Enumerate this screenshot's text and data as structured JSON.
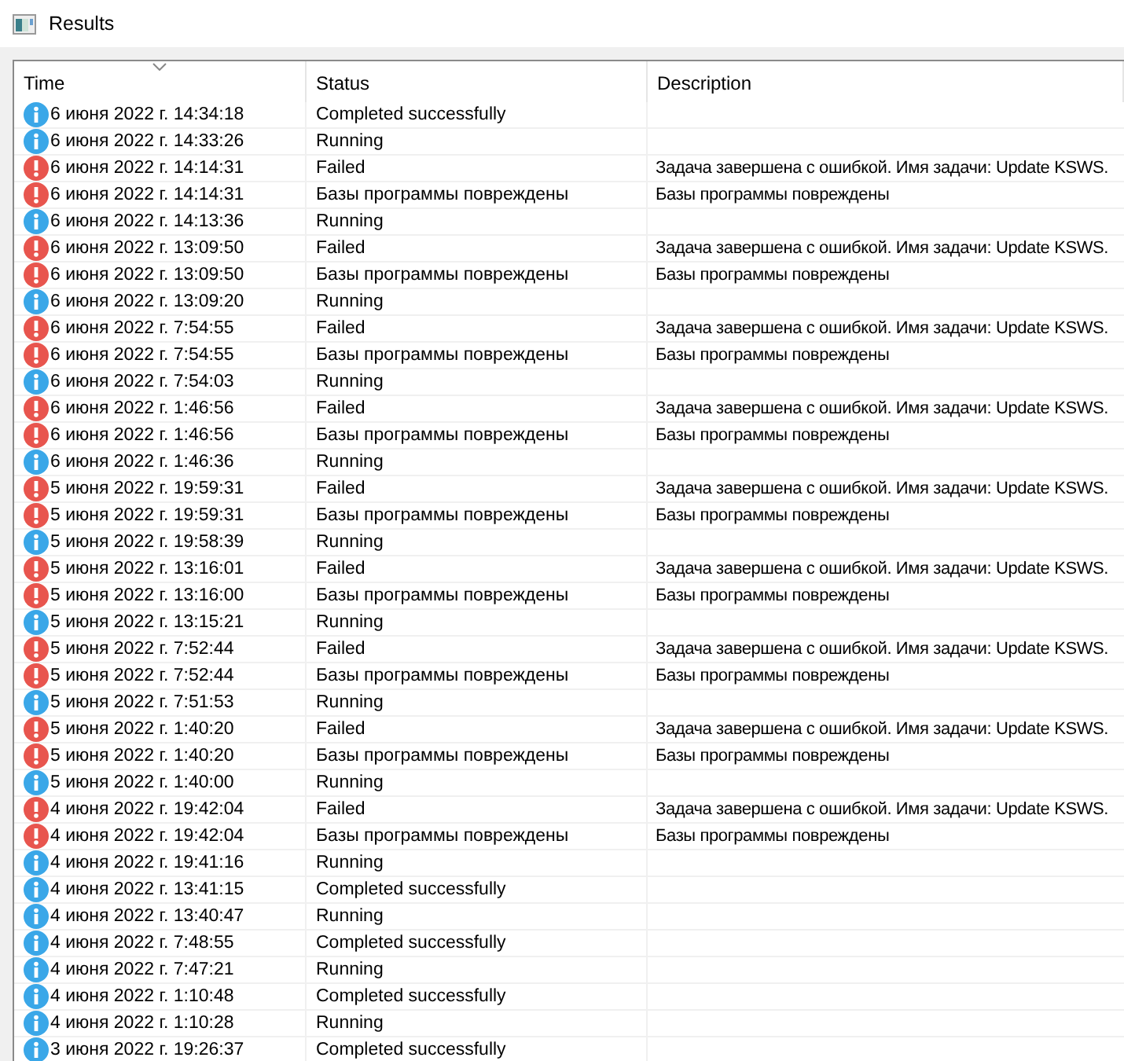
{
  "window": {
    "title": "Results"
  },
  "table": {
    "columns": [
      {
        "label": "Time",
        "sorted": true
      },
      {
        "label": "Status",
        "sorted": false
      },
      {
        "label": "Description",
        "sorted": false
      }
    ],
    "rows": [
      {
        "kind": "info",
        "time": "6 июня 2022 г. 14:34:18",
        "status": "Completed successfully",
        "description": ""
      },
      {
        "kind": "info",
        "time": "6 июня 2022 г. 14:33:26",
        "status": "Running",
        "description": ""
      },
      {
        "kind": "error",
        "time": "6 июня 2022 г. 14:14:31",
        "status": "Failed",
        "description": "Задача завершена с ошибкой. Имя задачи: Update KSWS."
      },
      {
        "kind": "error",
        "time": "6 июня 2022 г. 14:14:31",
        "status": "Базы программы повреждены",
        "description": "Базы программы повреждены"
      },
      {
        "kind": "info",
        "time": "6 июня 2022 г. 14:13:36",
        "status": "Running",
        "description": ""
      },
      {
        "kind": "error",
        "time": "6 июня 2022 г. 13:09:50",
        "status": "Failed",
        "description": "Задача завершена с ошибкой. Имя задачи: Update KSWS."
      },
      {
        "kind": "error",
        "time": "6 июня 2022 г. 13:09:50",
        "status": "Базы программы повреждены",
        "description": "Базы программы повреждены"
      },
      {
        "kind": "info",
        "time": "6 июня 2022 г. 13:09:20",
        "status": "Running",
        "description": ""
      },
      {
        "kind": "error",
        "time": "6 июня 2022 г. 7:54:55",
        "status": "Failed",
        "description": "Задача завершена с ошибкой. Имя задачи: Update KSWS."
      },
      {
        "kind": "error",
        "time": "6 июня 2022 г. 7:54:55",
        "status": "Базы программы повреждены",
        "description": "Базы программы повреждены"
      },
      {
        "kind": "info",
        "time": "6 июня 2022 г. 7:54:03",
        "status": "Running",
        "description": ""
      },
      {
        "kind": "error",
        "time": "6 июня 2022 г. 1:46:56",
        "status": "Failed",
        "description": "Задача завершена с ошибкой. Имя задачи: Update KSWS."
      },
      {
        "kind": "error",
        "time": "6 июня 2022 г. 1:46:56",
        "status": "Базы программы повреждены",
        "description": "Базы программы повреждены"
      },
      {
        "kind": "info",
        "time": "6 июня 2022 г. 1:46:36",
        "status": "Running",
        "description": ""
      },
      {
        "kind": "error",
        "time": "5 июня 2022 г. 19:59:31",
        "status": "Failed",
        "description": "Задача завершена с ошибкой. Имя задачи: Update KSWS."
      },
      {
        "kind": "error",
        "time": "5 июня 2022 г. 19:59:31",
        "status": "Базы программы повреждены",
        "description": "Базы программы повреждены"
      },
      {
        "kind": "info",
        "time": "5 июня 2022 г. 19:58:39",
        "status": "Running",
        "description": ""
      },
      {
        "kind": "error",
        "time": "5 июня 2022 г. 13:16:01",
        "status": "Failed",
        "description": "Задача завершена с ошибкой. Имя задачи: Update KSWS."
      },
      {
        "kind": "error",
        "time": "5 июня 2022 г. 13:16:00",
        "status": "Базы программы повреждены",
        "description": "Базы программы повреждены"
      },
      {
        "kind": "info",
        "time": "5 июня 2022 г. 13:15:21",
        "status": "Running",
        "description": ""
      },
      {
        "kind": "error",
        "time": "5 июня 2022 г. 7:52:44",
        "status": "Failed",
        "description": "Задача завершена с ошибкой. Имя задачи: Update KSWS."
      },
      {
        "kind": "error",
        "time": "5 июня 2022 г. 7:52:44",
        "status": "Базы программы повреждены",
        "description": "Базы программы повреждены"
      },
      {
        "kind": "info",
        "time": "5 июня 2022 г. 7:51:53",
        "status": "Running",
        "description": ""
      },
      {
        "kind": "error",
        "time": "5 июня 2022 г. 1:40:20",
        "status": "Failed",
        "description": "Задача завершена с ошибкой. Имя задачи: Update KSWS."
      },
      {
        "kind": "error",
        "time": "5 июня 2022 г. 1:40:20",
        "status": "Базы программы повреждены",
        "description": "Базы программы повреждены"
      },
      {
        "kind": "info",
        "time": "5 июня 2022 г. 1:40:00",
        "status": "Running",
        "description": ""
      },
      {
        "kind": "error",
        "time": "4 июня 2022 г. 19:42:04",
        "status": "Failed",
        "description": "Задача завершена с ошибкой. Имя задачи: Update KSWS."
      },
      {
        "kind": "error",
        "time": "4 июня 2022 г. 19:42:04",
        "status": "Базы программы повреждены",
        "description": "Базы программы повреждены"
      },
      {
        "kind": "info",
        "time": "4 июня 2022 г. 19:41:16",
        "status": "Running",
        "description": ""
      },
      {
        "kind": "info",
        "time": "4 июня 2022 г. 13:41:15",
        "status": "Completed successfully",
        "description": ""
      },
      {
        "kind": "info",
        "time": "4 июня 2022 г. 13:40:47",
        "status": "Running",
        "description": ""
      },
      {
        "kind": "info",
        "time": "4 июня 2022 г. 7:48:55",
        "status": "Completed successfully",
        "description": ""
      },
      {
        "kind": "info",
        "time": "4 июня 2022 г. 7:47:21",
        "status": "Running",
        "description": ""
      },
      {
        "kind": "info",
        "time": "4 июня 2022 г. 1:10:48",
        "status": "Completed successfully",
        "description": ""
      },
      {
        "kind": "info",
        "time": "4 июня 2022 г. 1:10:28",
        "status": "Running",
        "description": ""
      },
      {
        "kind": "info",
        "time": "3 июня 2022 г. 19:26:37",
        "status": "Completed successfully",
        "description": ""
      }
    ]
  }
}
